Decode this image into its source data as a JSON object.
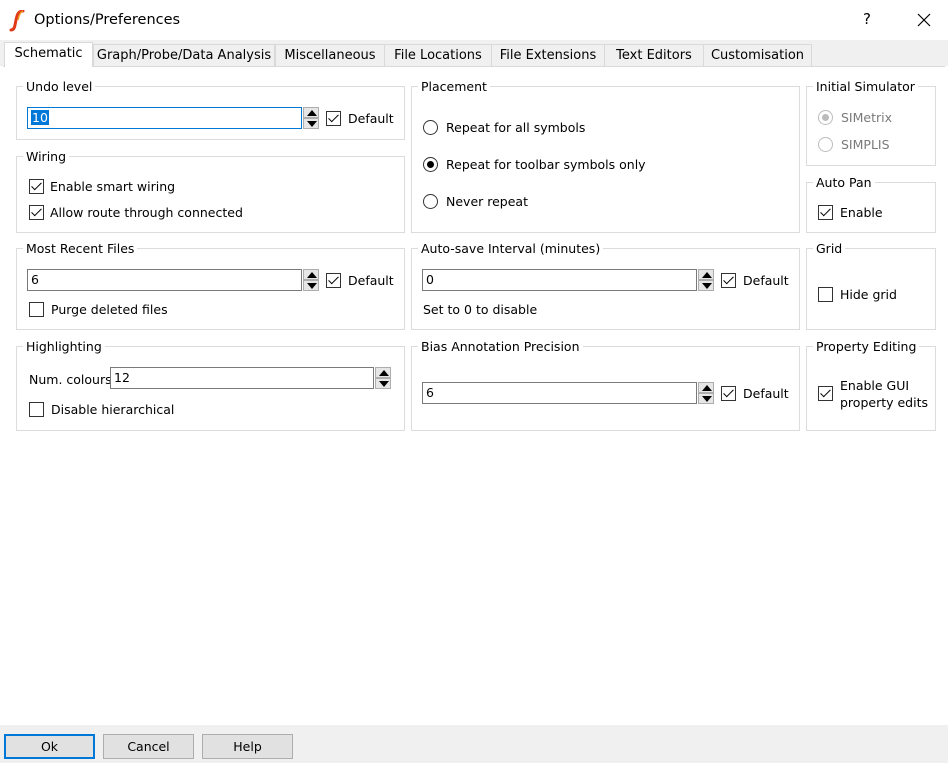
{
  "window": {
    "title": "Options/Preferences",
    "help_glyph": "?",
    "accent": "#0078d7"
  },
  "tabs": [
    {
      "label": "Schematic",
      "active": true
    },
    {
      "label": "Graph/Probe/Data Analysis"
    },
    {
      "label": "Miscellaneous"
    },
    {
      "label": "File Locations"
    },
    {
      "label": "File Extensions"
    },
    {
      "label": "Text Editors"
    },
    {
      "label": "Customisation"
    }
  ],
  "undo_level": {
    "title": "Undo level",
    "value": "10",
    "default_label": "Default",
    "default_checked": true
  },
  "wiring": {
    "title": "Wiring",
    "smart_wiring": {
      "label": "Enable smart wiring",
      "checked": true
    },
    "route_through": {
      "label": "Allow route through connected",
      "checked": true
    }
  },
  "recent_files": {
    "title": "Most Recent Files",
    "value": "6",
    "default_label": "Default",
    "default_checked": true,
    "purge": {
      "label": "Purge deleted files",
      "checked": false
    }
  },
  "highlighting": {
    "title": "Highlighting",
    "num_colours_label": "Num. colours",
    "num_colours_value": "12",
    "hierarchical": {
      "label": "Disable hierarchical",
      "checked": false
    }
  },
  "placement": {
    "title": "Placement",
    "options": [
      {
        "label": "Repeat for all symbols",
        "checked": false
      },
      {
        "label": "Repeat for toolbar symbols only",
        "checked": true
      },
      {
        "label": "Never repeat",
        "checked": false
      }
    ]
  },
  "autosave": {
    "title": "Auto-save Interval (minutes)",
    "value": "0",
    "default_label": "Default",
    "default_checked": true,
    "hint": "Set to 0 to disable"
  },
  "bias": {
    "title": "Bias Annotation Precision",
    "value": "6",
    "default_label": "Default",
    "default_checked": true
  },
  "initial_simulator": {
    "title": "Initial Simulator",
    "options": [
      {
        "label": "SIMetrix",
        "checked": true
      },
      {
        "label": "SIMPLIS",
        "checked": false
      }
    ]
  },
  "auto_pan": {
    "title": "Auto Pan",
    "label": "Enable",
    "checked": true
  },
  "grid": {
    "title": "Grid",
    "label": "Hide grid",
    "checked": false
  },
  "property_editing": {
    "title": "Property Editing",
    "label_line1": "Enable GUI",
    "label_line2": "property edits",
    "checked": true
  },
  "buttons": {
    "ok": "Ok",
    "cancel": "Cancel",
    "help": "Help"
  }
}
